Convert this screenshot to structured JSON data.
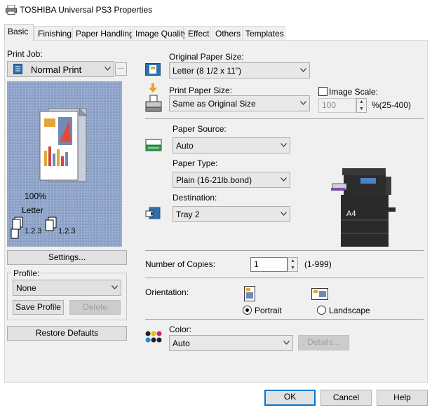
{
  "window": {
    "title": "TOSHIBA Universal PS3 Properties"
  },
  "tabs": [
    {
      "label": "Basic"
    },
    {
      "label": "Finishing"
    },
    {
      "label": "Paper Handling"
    },
    {
      "label": "Image Quality"
    },
    {
      "label": "Effect"
    },
    {
      "label": "Others"
    },
    {
      "label": "Templates"
    }
  ],
  "left": {
    "print_job_label": "Print Job:",
    "print_job_value": "Normal Print",
    "more_button": "...",
    "preview_zoom": "100%",
    "preview_paper": "Letter",
    "preview_copies_a": "1.2.3",
    "preview_copies_b": "1.2.3",
    "settings_button": "Settings...",
    "profile_label": "Profile:",
    "profile_value": "None",
    "save_profile_button": "Save Profile",
    "delete_button": "Delete",
    "restore_defaults_button": "Restore Defaults"
  },
  "paper": {
    "original_label": "Original Paper Size:",
    "original_value": "Letter (8 1/2 x 11\")",
    "print_label": "Print Paper Size:",
    "print_value": "Same as Original Size",
    "image_scale_label": "Image Scale:",
    "image_scale_value": "100",
    "image_scale_range": "%(25-400)",
    "source_label": "Paper Source:",
    "source_value": "Auto",
    "type_label": "Paper Type:",
    "type_value": "Plain (16-21lb.bond)",
    "destination_label": "Destination:",
    "destination_value": "Tray 2",
    "printer_tray_label": "A4"
  },
  "copies": {
    "label": "Number of Copies:",
    "value": "1",
    "range": "(1-999)"
  },
  "orientation": {
    "label": "Orientation:",
    "portrait": "Portrait",
    "landscape": "Landscape",
    "selected": "portrait"
  },
  "color": {
    "label": "Color:",
    "value": "Auto",
    "details_button": "Details..."
  },
  "footer": {
    "ok": "OK",
    "cancel": "Cancel",
    "help": "Help"
  }
}
